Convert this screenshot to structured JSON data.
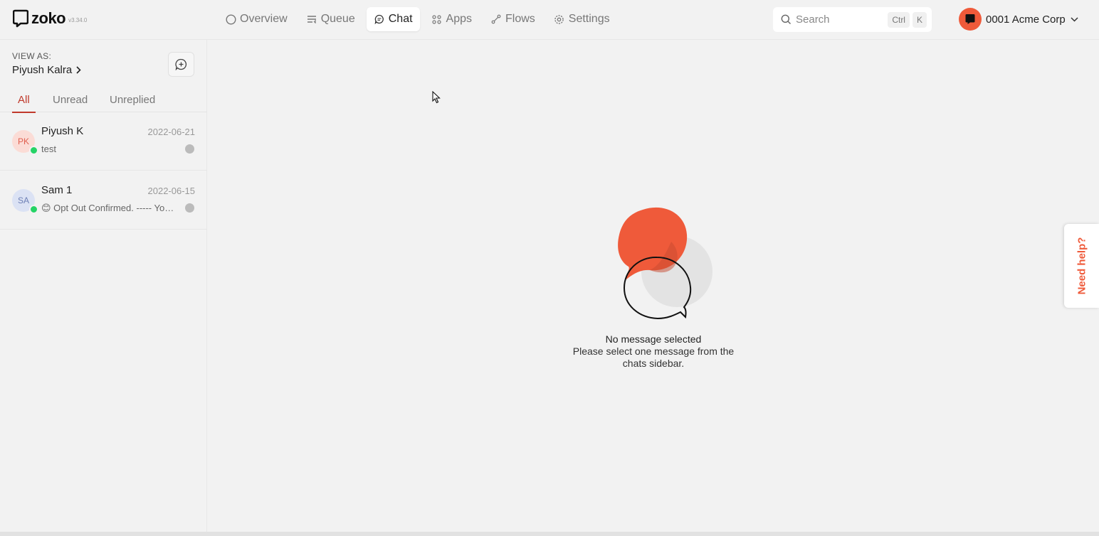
{
  "app": {
    "logo_text": "zoko",
    "version": "v3.34.0"
  },
  "nav": {
    "items": [
      {
        "label": "Overview",
        "icon": "circle-icon"
      },
      {
        "label": "Queue",
        "icon": "queue-icon"
      },
      {
        "label": "Chat",
        "icon": "chat-icon",
        "active": true
      },
      {
        "label": "Apps",
        "icon": "apps-icon"
      },
      {
        "label": "Flows",
        "icon": "flows-icon"
      },
      {
        "label": "Settings",
        "icon": "gear-icon"
      }
    ]
  },
  "search": {
    "placeholder": "Search",
    "shortcut_mod": "Ctrl",
    "shortcut_key": "K"
  },
  "account": {
    "name": "0001 Acme Corp"
  },
  "sidebar": {
    "view_as_label": "VIEW AS:",
    "view_as_user": "Piyush Kalra",
    "tabs": [
      {
        "label": "All",
        "active": true
      },
      {
        "label": "Unread"
      },
      {
        "label": "Unreplied"
      }
    ],
    "conversations": [
      {
        "initials": "PK",
        "name": "Piyush K",
        "date": "2022-06-21",
        "preview": "test"
      },
      {
        "initials": "SA",
        "name": "Sam 1",
        "date": "2022-06-15",
        "preview": "😊 Opt Out Confirmed. ----- You have been opted out"
      }
    ]
  },
  "empty_state": {
    "title": "No message selected",
    "subtitle_line1": "Please select one message from the",
    "subtitle_line2": "chats sidebar."
  },
  "help": {
    "label": "Need help?"
  },
  "colors": {
    "brand": "#ef5a3a",
    "active_tab": "#c0392b",
    "whatsapp": "#25d366"
  }
}
